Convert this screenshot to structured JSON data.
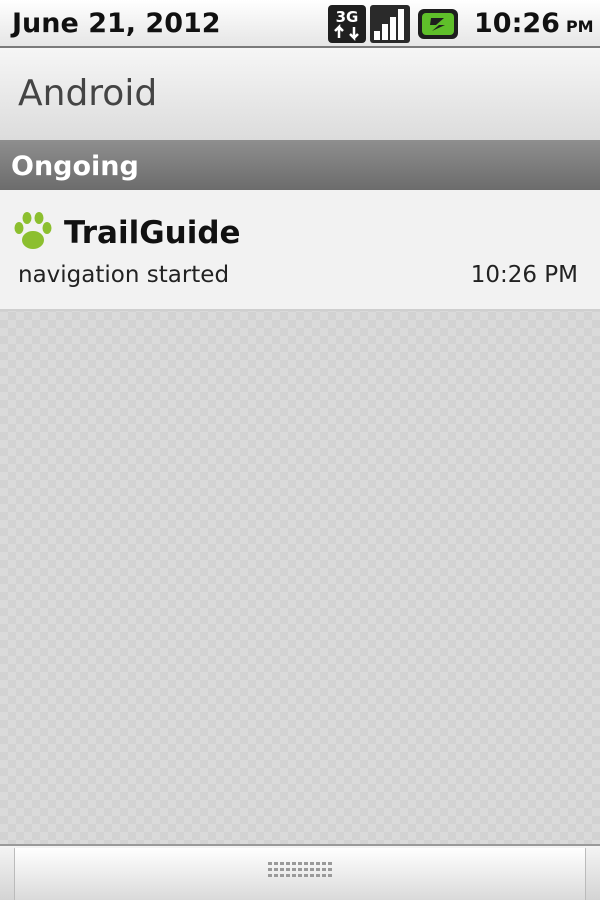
{
  "status_bar": {
    "date": "June 21, 2012",
    "network_label": "3G",
    "time": "10:26",
    "ampm": "PM",
    "icons": [
      "network-3g-icon",
      "signal-strength-icon",
      "battery-charging-icon"
    ]
  },
  "carrier": {
    "name": "Android"
  },
  "section": {
    "title": "Ongoing"
  },
  "notification": {
    "icon": "paw-icon",
    "title": "TrailGuide",
    "text": "navigation started",
    "time": "10:26 PM",
    "icon_color": "#8cbf2f"
  },
  "drawer_handle": {
    "icon": "grip-handle-icon"
  }
}
